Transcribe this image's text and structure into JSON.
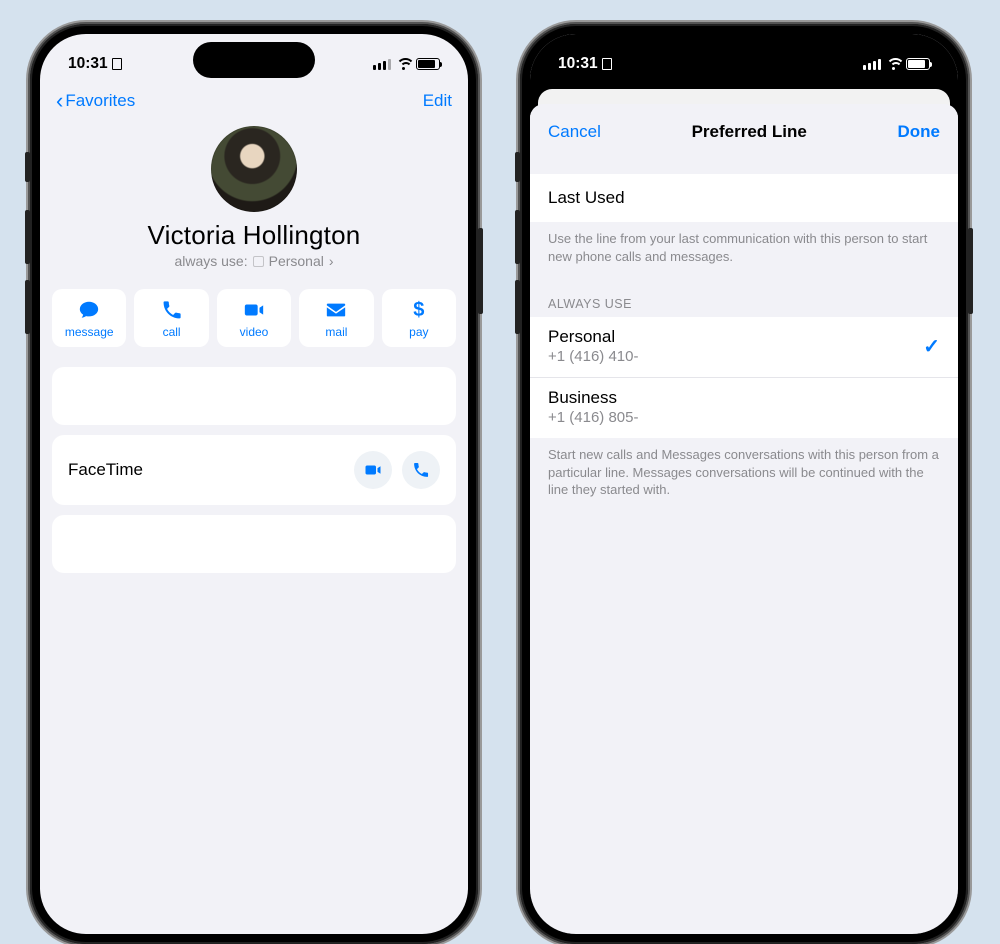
{
  "status": {
    "time": "10:31"
  },
  "left": {
    "back_label": "Favorites",
    "edit_label": "Edit",
    "name": "Victoria Hollington",
    "subline_prefix": "always use:",
    "subline_value": "Personal",
    "actions": [
      {
        "key": "message",
        "label": "message"
      },
      {
        "key": "call",
        "label": "call"
      },
      {
        "key": "video",
        "label": "video"
      },
      {
        "key": "mail",
        "label": "mail"
      },
      {
        "key": "pay",
        "label": "pay"
      }
    ],
    "facetime_label": "FaceTime"
  },
  "right": {
    "cancel": "Cancel",
    "title": "Preferred Line",
    "done": "Done",
    "last_used_label": "Last Used",
    "last_used_note": "Use the line from your last communication with this person to start new phone calls and messages.",
    "section_head": "ALWAYS USE",
    "lines": [
      {
        "name": "Personal",
        "number": "+1 (416) 410-",
        "selected": true
      },
      {
        "name": "Business",
        "number": "+1 (416) 805-",
        "selected": false
      }
    ],
    "always_note": "Start new calls and Messages conversations with this person from a particular line. Messages conversations will be continued with the line they started with."
  }
}
